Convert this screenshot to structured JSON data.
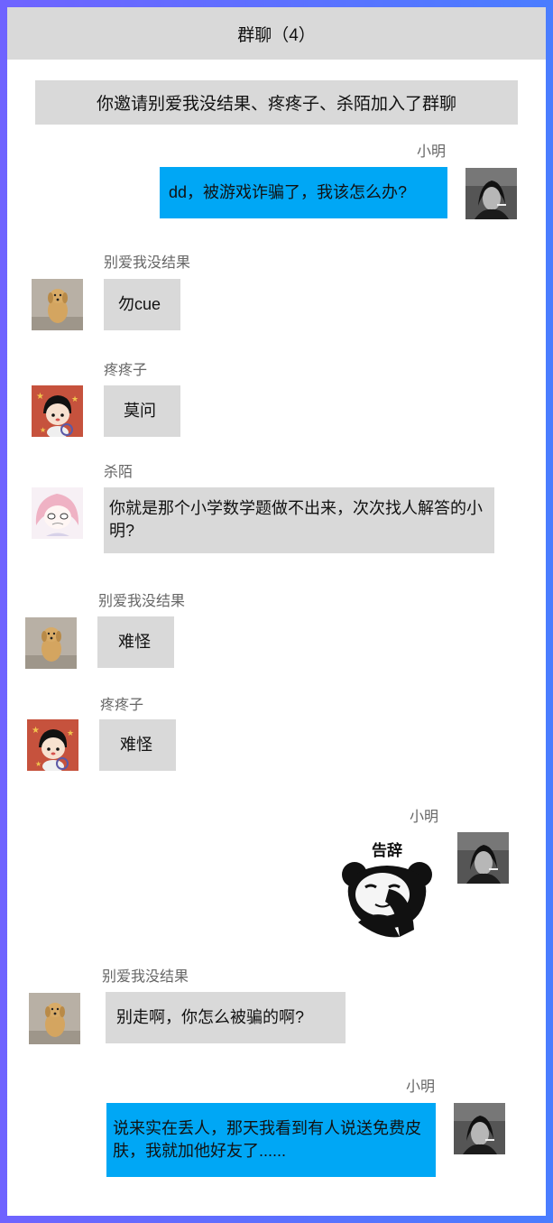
{
  "header": {
    "title": "群聊（4）"
  },
  "system_message": "你邀请别爱我没结果、疼疼子、杀陌加入了群聊",
  "messages": [
    {
      "sender": "小明",
      "text": "dd，被游戏诈骗了，我该怎么办?",
      "side": "right",
      "avatar": "man-avatar"
    },
    {
      "sender": "别爱我没结果",
      "text": "勿cue",
      "side": "left",
      "avatar": "dog-avatar"
    },
    {
      "sender": "疼疼子",
      "text": "莫问",
      "side": "left",
      "avatar": "cartoon-kid-avatar"
    },
    {
      "sender": "杀陌",
      "text": "你就是那个小学数学题做不出来，次次找人解答的小明?",
      "side": "left",
      "avatar": "anime-girl-avatar"
    },
    {
      "sender": "别爱我没结果",
      "text": "难怪",
      "side": "left",
      "avatar": "dog-avatar"
    },
    {
      "sender": "疼疼子",
      "text": "难怪",
      "side": "left",
      "avatar": "cartoon-kid-avatar"
    },
    {
      "sender": "小明",
      "sticker_text": "告辞",
      "side": "right",
      "avatar": "man-avatar"
    },
    {
      "sender": "别爱我没结果",
      "text": "别走啊，你怎么被骗的啊?",
      "side": "left",
      "avatar": "dog-avatar"
    },
    {
      "sender": "小明",
      "text": "说来实在丢人，那天我看到有人说送免费皮肤，我就加他好友了......",
      "side": "right",
      "avatar": "man-avatar"
    }
  ],
  "colors": {
    "header_bg": "#d9d9d9",
    "bubble_gray": "#d9d9d9",
    "bubble_blue": "#00a7f5",
    "border_gradient_start": "#6f63ff",
    "border_gradient_end": "#4a7dff"
  }
}
